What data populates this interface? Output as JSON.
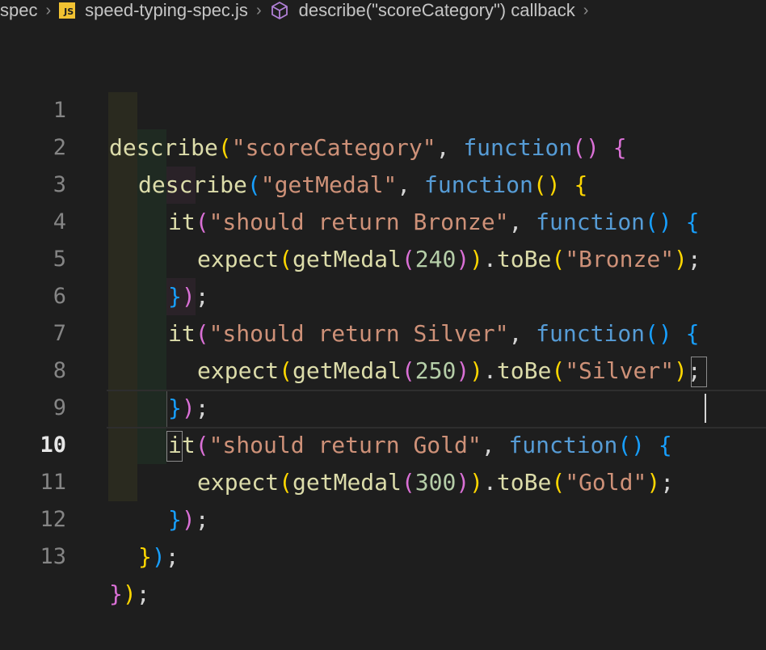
{
  "breadcrumb": {
    "folder": "spec",
    "file": "speed-typing-spec.js",
    "file_icon_label": "JS",
    "symbol": "describe(\"scoreCategory\") callback",
    "icons": [
      "js-file-icon",
      "symbol-method-icon",
      "chevron-right-icon"
    ]
  },
  "editor": {
    "active_line": 10,
    "line_numbers": [
      "1",
      "2",
      "3",
      "4",
      "5",
      "6",
      "7",
      "8",
      "9",
      "10",
      "11",
      "12",
      "13"
    ],
    "lines": [
      {
        "t1": "describe",
        "t2": "(",
        "t3": "\"scoreCategory\"",
        "t4": ", ",
        "t5": "function",
        "t6": "() {"
      },
      {
        "t1": "describe",
        "t2": "(",
        "t3": "\"getMedal\"",
        "t4": ", ",
        "t5": "function",
        "t6": "() {"
      },
      {
        "t1": "it",
        "t2": "(",
        "t3": "\"should return Bronze\"",
        "t4": ", ",
        "t5": "function",
        "t6": "() {"
      },
      {
        "t1": "expect",
        "t2": "getMedal",
        "num": "240",
        "t3": "toBe",
        "t4": "\"Bronze\""
      },
      {
        "t1": "});"
      },
      {
        "t1": "it",
        "t2": "(",
        "t3": "\"should return Silver\"",
        "t4": ", ",
        "t5": "function",
        "t6": "() {"
      },
      {
        "t1": "expect",
        "t2": "getMedal",
        "num": "250",
        "t3": "toBe",
        "t4": "\"Silver\""
      },
      {
        "t1": "});"
      },
      {
        "t1": "it",
        "t2": "(",
        "t3": "\"should return Gold\"",
        "t4": ", ",
        "t5": "function",
        "t6": "() {"
      },
      {
        "t1": "expect",
        "t2": "getMedal",
        "num": "300",
        "t3": "toBe",
        "t4": "\"Gold\""
      },
      {
        "t1": "});"
      },
      {
        "t1": "});"
      },
      {
        "t1": "});"
      }
    ]
  },
  "colors": {
    "background": "#1e1e1e",
    "function_call": "#dcdcaa",
    "string": "#ce9178",
    "keyword": "#569cd6",
    "number": "#b5cea8",
    "bracket_1": "#ffd700",
    "bracket_2": "#da70d6",
    "bracket_3": "#179fff"
  }
}
